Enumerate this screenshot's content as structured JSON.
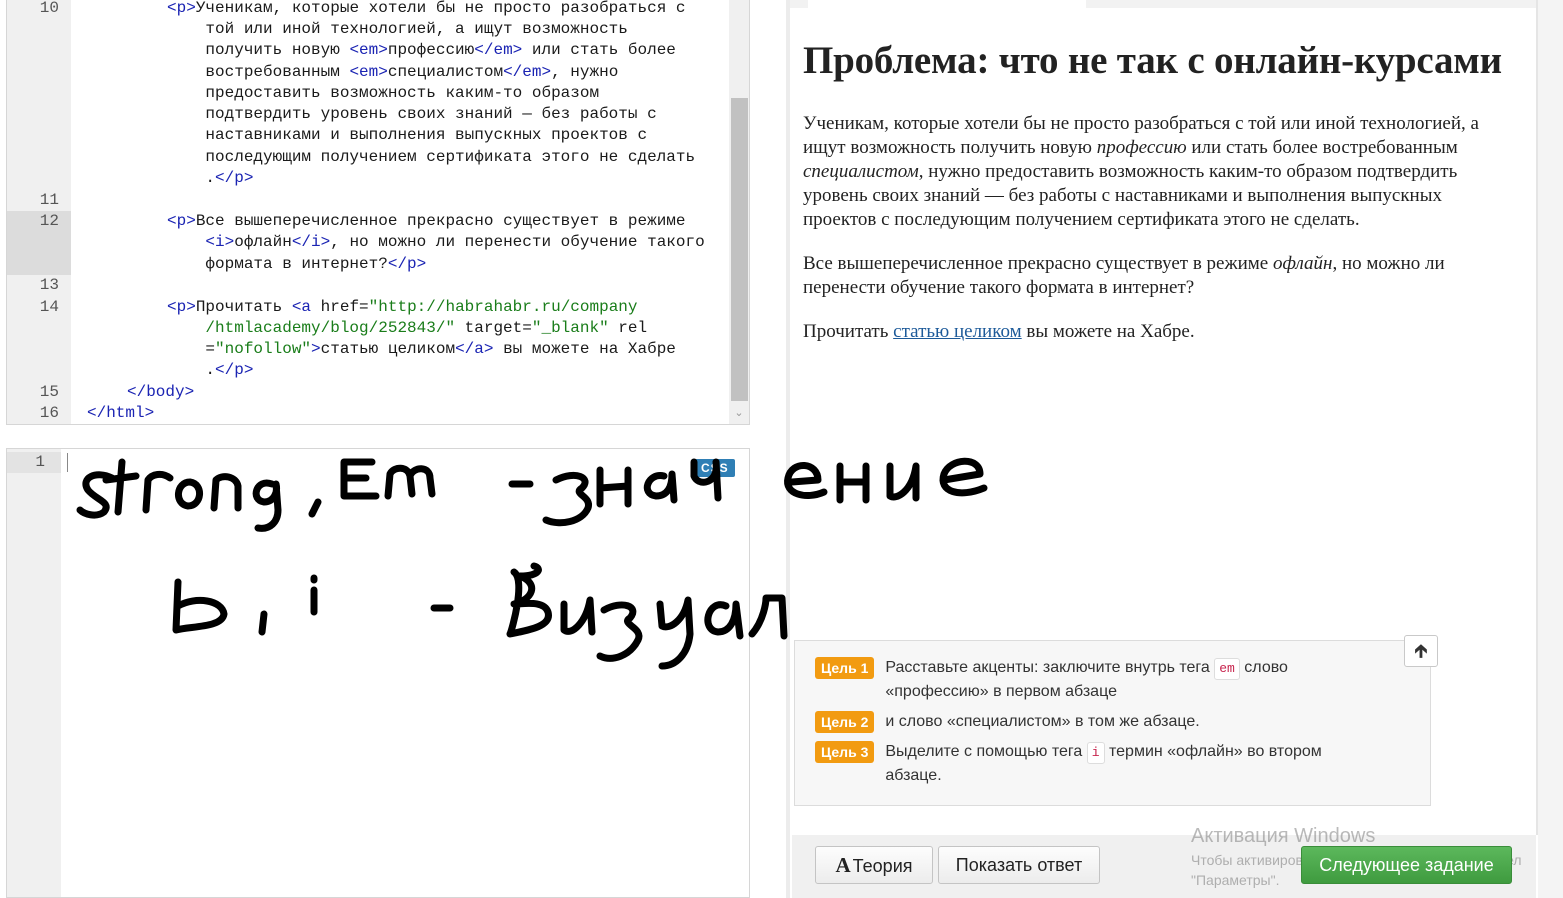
{
  "html_editor": {
    "line_numbers": [
      "10",
      "11",
      "12",
      "13",
      "14",
      "15",
      "16"
    ],
    "lines": [
      [
        {
          "t": "tag",
          "v": "<p>"
        },
        {
          "t": "txt",
          "v": "Ученикам, которые хотели бы не просто разобраться с"
        }
      ],
      [
        {
          "t": "txt",
          "v": "    той или иной технологией, а ищут возможность"
        }
      ],
      [
        {
          "t": "txt",
          "v": "    получить новую "
        },
        {
          "t": "tag",
          "v": "<em>"
        },
        {
          "t": "txt",
          "v": "профессию"
        },
        {
          "t": "tag",
          "v": "</em>"
        },
        {
          "t": "txt",
          "v": " или стать более"
        }
      ],
      [
        {
          "t": "txt",
          "v": "    востребованным "
        },
        {
          "t": "tag",
          "v": "<em>"
        },
        {
          "t": "txt",
          "v": "специалистом"
        },
        {
          "t": "tag",
          "v": "</em>"
        },
        {
          "t": "txt",
          "v": ", нужно"
        }
      ],
      [
        {
          "t": "txt",
          "v": "    предоставить возможность каким-то образом"
        }
      ],
      [
        {
          "t": "txt",
          "v": "    подтвердить уровень своих знаний — без работы с"
        }
      ],
      [
        {
          "t": "txt",
          "v": "    наставниками и выполнения выпускных проектов с"
        }
      ],
      [
        {
          "t": "txt",
          "v": "    последующим получением сертификата этого не сделать"
        }
      ],
      [
        {
          "t": "txt",
          "v": "    ."
        },
        {
          "t": "tag",
          "v": "</p>"
        }
      ],
      [
        {
          "t": "txt",
          "v": ""
        }
      ],
      [
        {
          "t": "tag",
          "v": "<p>"
        },
        {
          "t": "txt",
          "v": "Все вышеперечисленное прекрасно существует в режиме"
        }
      ],
      [
        {
          "t": "txt",
          "v": "    "
        },
        {
          "t": "tag",
          "v": "<i>"
        },
        {
          "t": "txt",
          "v": "офлайн"
        },
        {
          "t": "tag",
          "v": "</i>"
        },
        {
          "t": "txt",
          "v": ", но можно ли перенести обучение такого"
        }
      ],
      [
        {
          "t": "txt",
          "v": "    формата в интернет?"
        },
        {
          "t": "tag",
          "v": "</p>"
        }
      ],
      [
        {
          "t": "txt",
          "v": ""
        }
      ],
      [
        {
          "t": "tag",
          "v": "<p>"
        },
        {
          "t": "txt",
          "v": "Прочитать "
        },
        {
          "t": "tag",
          "v": "<a "
        },
        {
          "t": "attr",
          "v": "href="
        },
        {
          "t": "str",
          "v": "\"http://habrahabr.ru/company"
        }
      ],
      [
        {
          "t": "str",
          "v": "    /htmlacademy/blog/252843/\""
        },
        {
          "t": "attr",
          "v": " target="
        },
        {
          "t": "str",
          "v": "\"_blank\""
        },
        {
          "t": "attr",
          "v": " rel"
        }
      ],
      [
        {
          "t": "attr",
          "v": "    ="
        },
        {
          "t": "str",
          "v": "\"nofollow\""
        },
        {
          "t": "tag",
          "v": ">"
        },
        {
          "t": "txt",
          "v": "статью целиком"
        },
        {
          "t": "tag",
          "v": "</a>"
        },
        {
          "t": "txt",
          "v": " вы можете на Хабре"
        }
      ],
      [
        {
          "t": "txt",
          "v": "    ."
        },
        {
          "t": "tag",
          "v": "</p>"
        }
      ],
      [
        {
          "t": "tag",
          "v": "</body>"
        }
      ],
      [
        {
          "t": "tag",
          "v": "</html>"
        }
      ]
    ]
  },
  "css_editor": {
    "line_number": "1",
    "badge": "CSS"
  },
  "preview": {
    "heading": "Проблема: что не так с онлайн-курсами",
    "p1_a": "Ученикам, которые хотели бы не просто разобраться с той или иной технологией, а ищут возможность получить новую ",
    "p1_em1": "профессию",
    "p1_b": " или стать более востребованным ",
    "p1_em2": "специалистом",
    "p1_c": ", нужно предоставить возможность каким-то образом подтвердить уровень своих знаний — без работы с наставниками и выполнения выпускных проектов с последующим получением сертификата этого не сделать.",
    "p2_a": "Все вышеперечисленное прекрасно существует в режиме ",
    "p2_i": "офлайн",
    "p2_b": ", но можно ли перенести обучение такого формата в интернет?",
    "p3_a": "Прочитать ",
    "p3_link": "статью целиком",
    "p3_b": " вы можете на Хабре."
  },
  "goals": {
    "items": [
      {
        "badge": "Цель 1",
        "before": "Расставьте акценты: заключите внутрь тега ",
        "code": "em",
        "after": " слово «профессию» в первом абзаце"
      },
      {
        "badge": "Цель 2",
        "before": "и слово «специалистом» в том же абзаце.",
        "code": "",
        "after": ""
      },
      {
        "badge": "Цель 3",
        "before": "Выделите с помощью тега ",
        "code": "i",
        "after": " термин «офлайн» во втором абзаце."
      }
    ],
    "scroll_top_icon": "arrow-up-icon"
  },
  "actions": {
    "theory_glyph": "A",
    "theory_label": "Теория",
    "answer_label": "Показать ответ",
    "next_label": "Следующее задание"
  },
  "watermark": {
    "title": "Активация Windows",
    "subtitle": "Чтобы активировать Windows, перейдите в раздел \"Параметры\"."
  },
  "handwriting": {
    "line1": "strong, Em - значение",
    "line2": "b, i - визуал"
  },
  "colors": {
    "tag": "#1b24b3",
    "string": "#1a7d1a",
    "goal_badge": "#f29b11",
    "next_button": "#4cae4c",
    "link": "#1d5a99"
  }
}
